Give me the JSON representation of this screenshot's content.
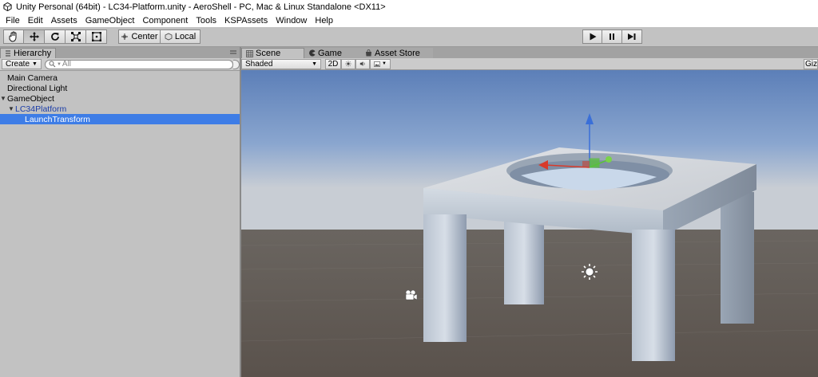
{
  "window": {
    "title": "Unity Personal (64bit) - LC34-Platform.unity - AeroShell - PC, Mac & Linux Standalone <DX11>"
  },
  "menu": [
    "File",
    "Edit",
    "Assets",
    "GameObject",
    "Component",
    "Tools",
    "KSPAssets",
    "Window",
    "Help"
  ],
  "toolbar": {
    "tools": [
      "hand-tool",
      "move-tool",
      "rotate-tool",
      "scale-tool",
      "rect-tool"
    ],
    "pivot_center": "Center",
    "pivot_local": "Local",
    "playback": [
      "play",
      "pause",
      "step"
    ]
  },
  "hierarchy": {
    "tab": "Hierarchy",
    "create_label": "Create",
    "search_placeholder": "All",
    "items": [
      {
        "label": "Main Camera"
      },
      {
        "label": "Directional Light"
      },
      {
        "label": "GameObject"
      },
      {
        "label": "LC34Platform"
      },
      {
        "label": "LaunchTransform"
      }
    ]
  },
  "scene_tabs": {
    "scene": "Scene",
    "game": "Game",
    "store": "Asset Store"
  },
  "scene_toolbar": {
    "shading": "Shaded",
    "mode_2d": "2D",
    "gizmos": "Gizm"
  },
  "colors": {
    "selection": "#3e7de6",
    "sky_top": "#5c7fb8",
    "ground": "#5e564f"
  }
}
